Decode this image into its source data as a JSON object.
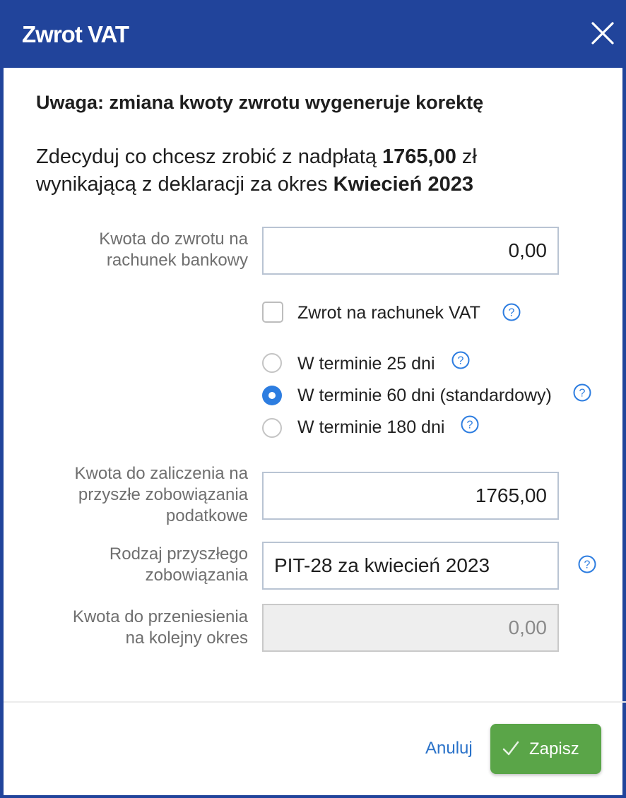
{
  "dialog": {
    "title": "Zwrot VAT",
    "close_icon": "close-icon",
    "warning": "Uwaga: zmiana kwoty zwrotu wygeneruje korektę",
    "intro": {
      "part1": "Zdecyduj co chcesz zrobić z nadpłatą ",
      "amount": "1765,00",
      "part2": " zł",
      "part3": "wynikającą z deklaracji za okres ",
      "period": "Kwiecień 2023"
    }
  },
  "form": {
    "refund_amount": {
      "label_line1": "Kwota do zwrotu na",
      "label_line2": "rachunek bankowy",
      "value": "0,00"
    },
    "vat_account": {
      "label": "Zwrot na rachunek VAT",
      "checked": false
    },
    "terms": [
      {
        "label": "W terminie 25 dni",
        "selected": false
      },
      {
        "label": "W terminie 60 dni (standardowy)",
        "selected": true
      },
      {
        "label": "W terminie 180 dni",
        "selected": false
      }
    ],
    "future_amount": {
      "label_line1": "Kwota do zaliczenia na",
      "label_line2": "przyszłe zobowiązania",
      "label_line3": "podatkowe",
      "value": "1765,00"
    },
    "liability_type": {
      "label_line1": "Rodzaj przyszłego",
      "label_line2": "zobowiązania",
      "value": "PIT-28 za kwiecień 2023"
    },
    "carry_over": {
      "label_line1": "Kwota do przeniesienia",
      "label_line2": "na kolejny okres",
      "value": "0,00"
    }
  },
  "footer": {
    "cancel_label": "Anuluj",
    "save_label": "Zapisz"
  },
  "colors": {
    "header": "#21449b",
    "accent": "#2d7de0",
    "save": "#5aa548",
    "link": "#2a72c9"
  },
  "icons": {
    "help": "question-circle-icon",
    "save": "checkmark-icon"
  }
}
